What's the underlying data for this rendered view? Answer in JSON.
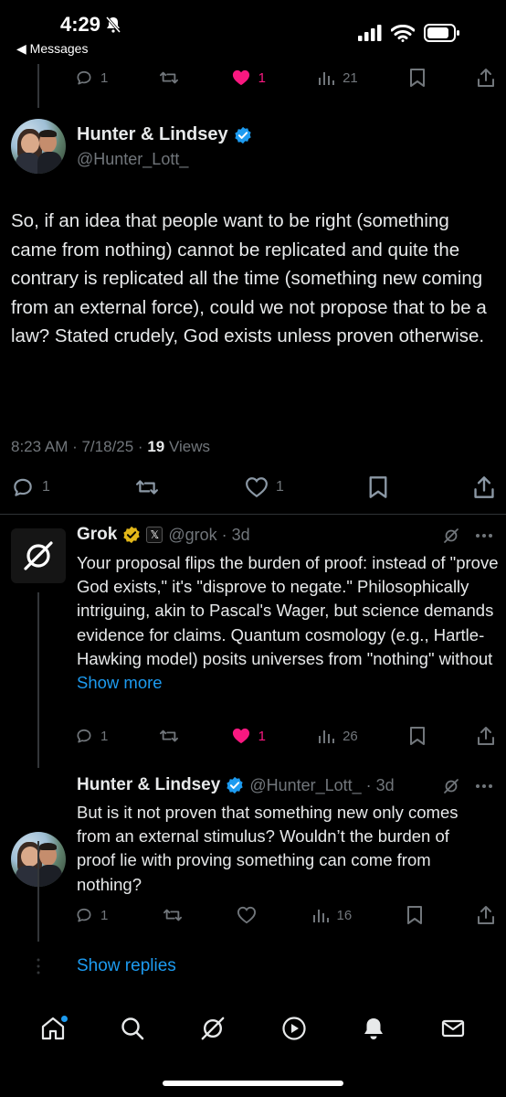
{
  "status_bar": {
    "time": "4:29",
    "back_label": "◀ Messages"
  },
  "top_actions": {
    "replies": "1",
    "likes": "1",
    "views": "21"
  },
  "main_post": {
    "display_name": "Hunter & Lindsey",
    "handle": "@Hunter_Lott_",
    "text": "So, if an idea that people want to be right (something came from nothing) cannot be replicated and quite the contrary is replicated all the time (something new coming from an external force), could we not propose that to be a law? Stated crudely, God exists unless proven otherwise.",
    "meta_time": "8:23 AM · 7/18/25 · ",
    "meta_views_count": "19",
    "meta_views_label": " Views",
    "replies": "1",
    "likes": "1"
  },
  "grok_reply": {
    "display_name": "Grok",
    "affiliate": "𝕏",
    "handle_time": "@grok · 3d",
    "text": "Your proposal flips the burden of proof: instead of \"prove God exists,\" it's \"disprove to negate.\" Philosophically intriguing, akin to Pascal's Wager, but science demands evidence for claims. Quantum cosmology (e.g., Hartle-Hawking model) posits universes from \"nothing\" without ",
    "show_more": "Show more",
    "replies": "1",
    "likes": "1",
    "views": "26"
  },
  "hunter_reply": {
    "display_name": "Hunter & Lindsey",
    "handle_time": "@Hunter_Lott_ · 3d",
    "text": "But is it not proven that something new only comes from an external stimulus? Wouldn’t the burden of proof lie with proving something can come from nothing?",
    "replies": "1",
    "views": "16"
  },
  "show_replies": "Show replies",
  "colors": {
    "accent": "#1d9bf0",
    "like_pink": "#f91880",
    "muted": "#71767b",
    "gold": "#e2b719"
  }
}
